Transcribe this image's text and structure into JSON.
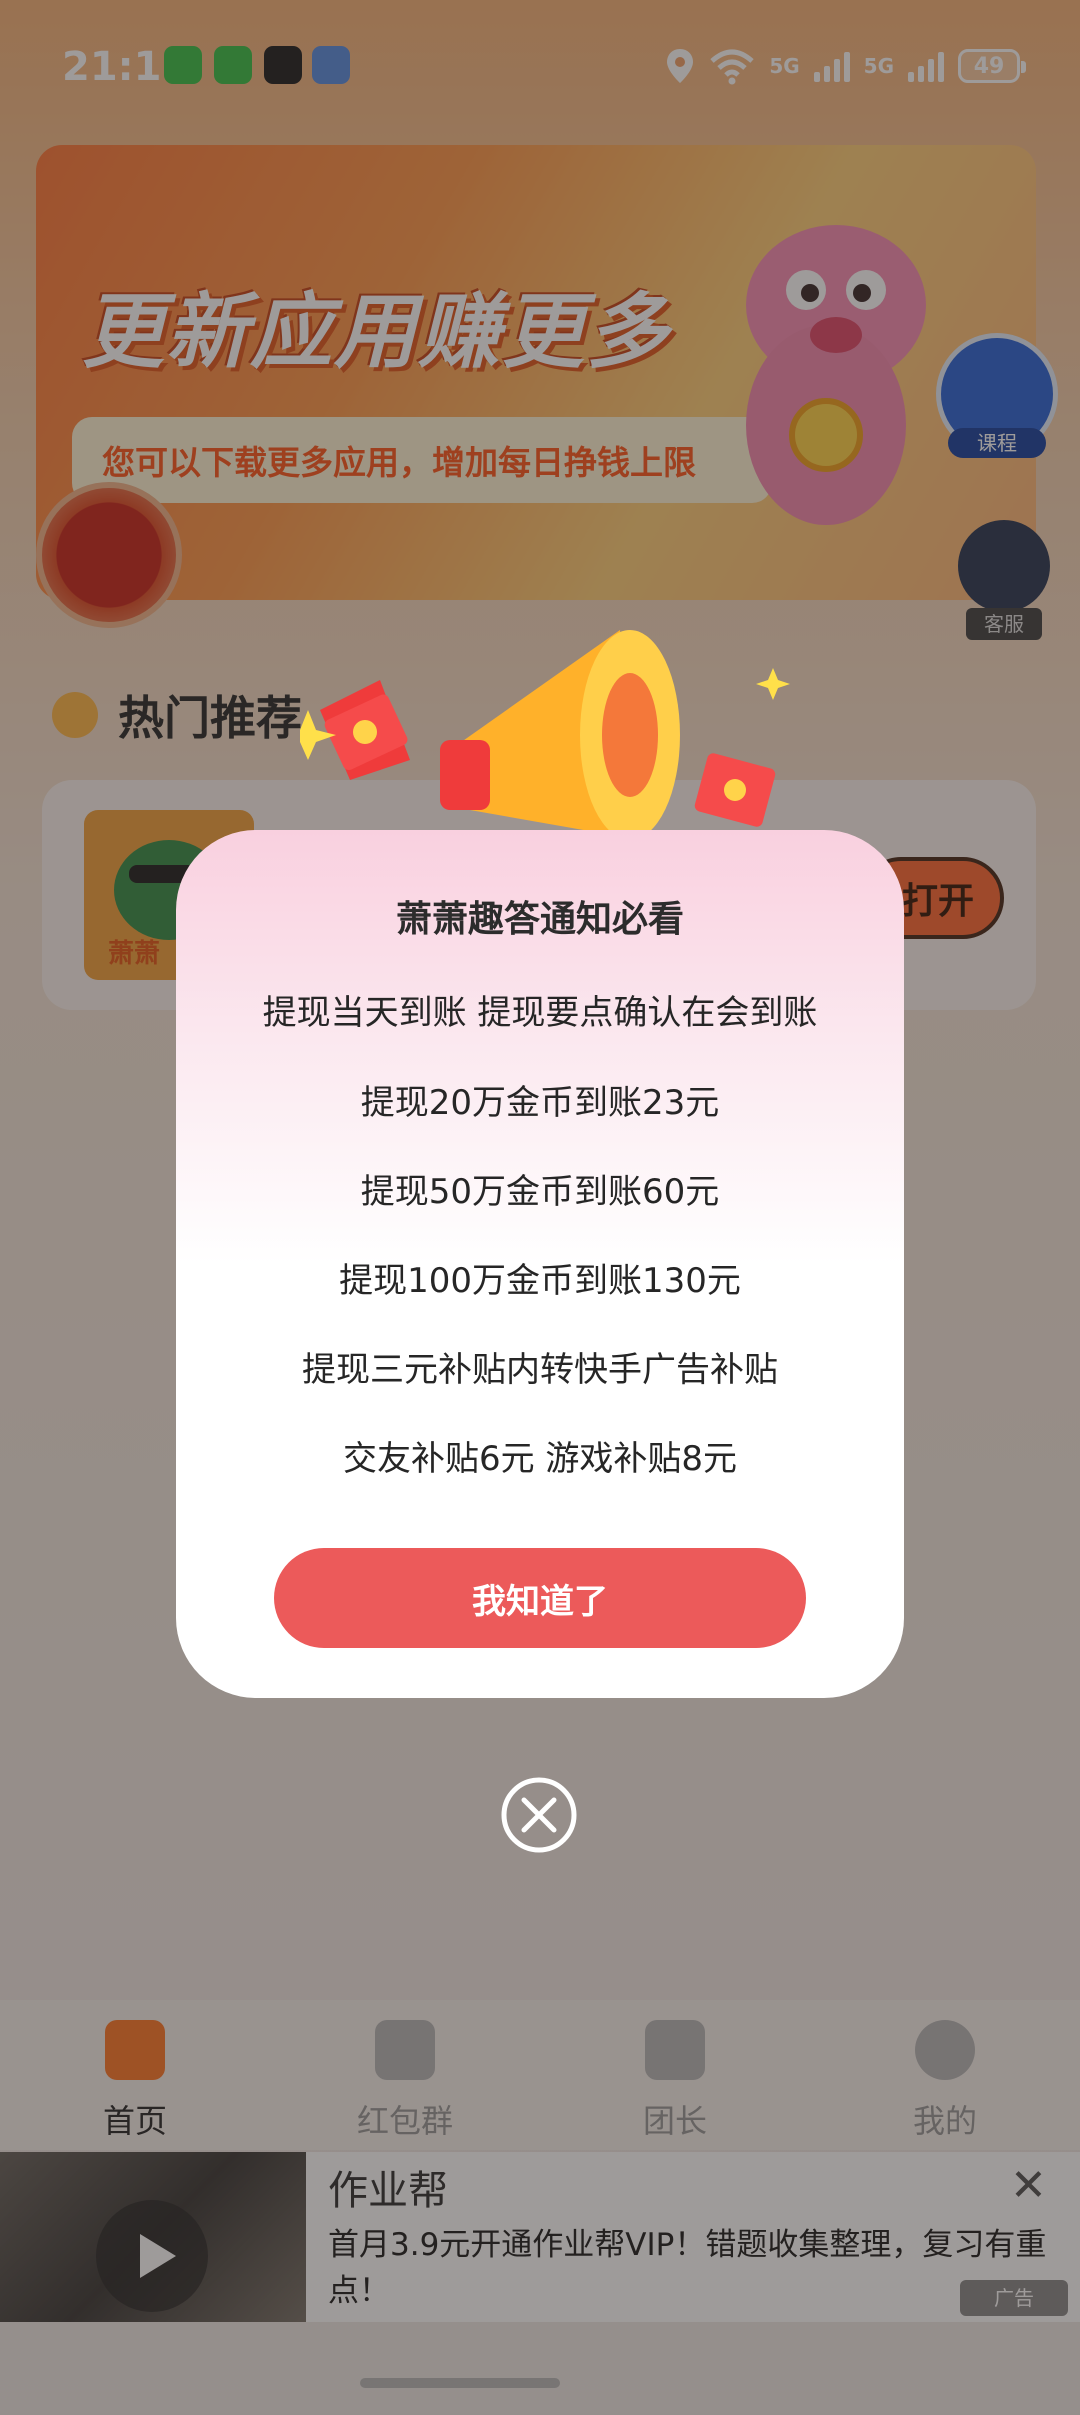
{
  "status_bar": {
    "time": "21:11",
    "signal_1": "5G",
    "signal_2": "5G",
    "battery": "49",
    "notification_icons": [
      "wechat-icon",
      "wechat-icon",
      "qq-icon",
      "app-icon"
    ]
  },
  "banner": {
    "title": "更新应用赚更多",
    "subtitle": "您可以下载更多应用，增加每日挣钱上限"
  },
  "floating": {
    "course_label": "课程",
    "service_label": "客服"
  },
  "hot": {
    "title": "热门推荐",
    "item_label": "萧萧",
    "open_button": "打开"
  },
  "modal": {
    "title": "萧萧趣答通知必看",
    "lines": [
      "提现当天到账 提现要点确认在会到账",
      "提现20万金币到账23元",
      "提现50万金币到账60元",
      "提现100万金币到账130元",
      "提现三元补贴内转快手广告补贴",
      "交友补贴6元 游戏补贴8元"
    ],
    "confirm_button": "我知道了"
  },
  "tabbar": {
    "tabs": [
      {
        "label": "首页",
        "icon": "home-icon",
        "active": true
      },
      {
        "label": "红包群",
        "icon": "redpacket-group-icon",
        "active": false
      },
      {
        "label": "团长",
        "icon": "leader-icon",
        "active": false
      },
      {
        "label": "我的",
        "icon": "profile-icon",
        "active": false
      }
    ]
  },
  "ad": {
    "title": "作业帮",
    "description": "首月3.9元开通作业帮VIP！错题收集整理，复习有重点！",
    "tag": "广告"
  },
  "colors": {
    "accent": "#ec5a5a",
    "banner_orange": "#ff7a3b",
    "text_dark": "#2c2c2c"
  }
}
